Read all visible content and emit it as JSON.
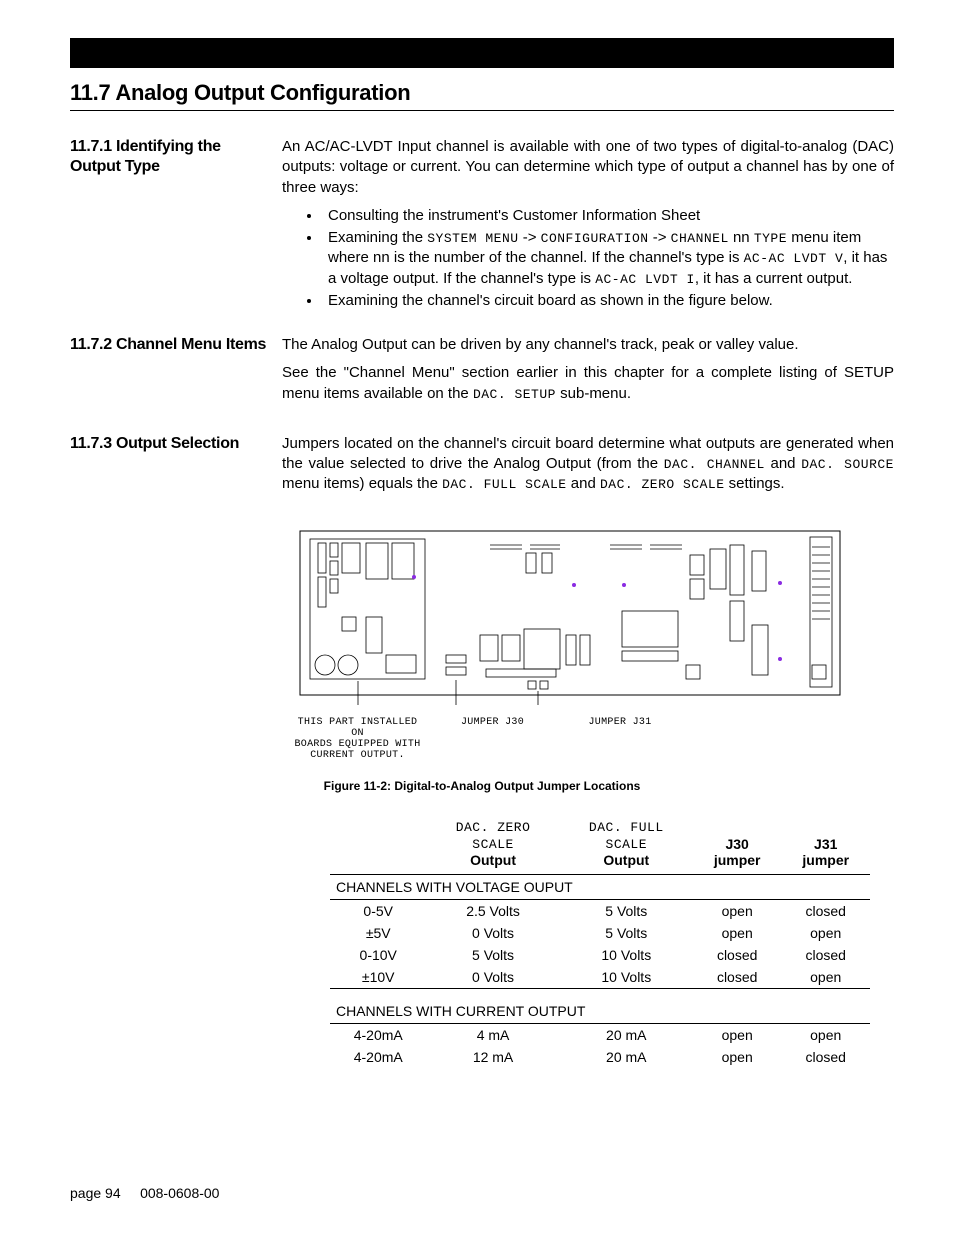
{
  "section_title": "11.7  Analog Output Configuration",
  "subsections": {
    "s1": {
      "heading": "11.7.1 Identifying the Output Type",
      "intro": "An AC/AC-LVDT Input channel is available with one of two types of digital-to-analog (DAC) outputs: voltage or current.  You can determine which type of output a channel has by one of three ways:",
      "bullets": {
        "b1": "Consulting the instrument's Customer Information Sheet",
        "b2_pre": "Examining the ",
        "b2_menu1": "SYSTEM MENU",
        "b2_mid1": " -> ",
        "b2_menu2": "CONFIGURATION",
        "b2_mid2": " -> ",
        "b2_menu3": "CHANNEL",
        "b2_mid3": " nn ",
        "b2_menu4": "TYPE",
        "b2_post1": " menu item where nn is the number of the channel. If the channel's type is ",
        "b2_type1": "AC-AC LVDT V",
        "b2_post2": ", it has a voltage output. If the channel's type is ",
        "b2_type2": "AC-AC LVDT I",
        "b2_post3": ", it has a current output.",
        "b3": "Examining the channel's circuit board as shown in the figure below."
      }
    },
    "s2": {
      "heading": "11.7.2 Channel Menu Items",
      "p1": "The Analog Output can be driven by any channel's track, peak or valley value.",
      "p2_pre": "See the \"Channel Menu\" section earlier in this chapter for a complete listing of SETUP menu items available on the ",
      "p2_mono": "DAC. SETUP",
      "p2_post": " sub-menu."
    },
    "s3": {
      "heading": "11.7.3 Output Selection",
      "p_pre": "Jumpers located on the channel's circuit board determine what outputs are generated when the value selected to drive the Analog Output (from the ",
      "p_m1": "DAC. CHANNEL",
      "p_mid1": " and ",
      "p_m2": "DAC. SOURCE",
      "p_mid2": " menu items) equals the ",
      "p_m3": "DAC. FULL SCALE",
      "p_mid3": " and ",
      "p_m4": "DAC. ZERO SCALE",
      "p_post": " settings."
    }
  },
  "diagram": {
    "install_note_l1": "THIS PART INSTALLED ON",
    "install_note_l2": "BOARDS EQUIPPED WITH",
    "install_note_l3": "CURRENT OUTPUT.",
    "j30_label": "JUMPER J30",
    "j31_label": "JUMPER J31"
  },
  "figure_caption": "Figure 11-2: Digital-to-Analog Output Jumper Locations",
  "table": {
    "headers": {
      "col1": "",
      "col2_mono": "DAC. ZERO SCALE",
      "col2_b": "Output",
      "col3_mono": "DAC. FULL SCALE",
      "col3_b": "Output",
      "col4_a": "J30",
      "col4_b": "jumper",
      "col5_a": "J31",
      "col5_b": "jumper"
    },
    "section1": "CHANNELS WITH VOLTAGE OUPUT",
    "section2": "CHANNELS WITH CURRENT OUTPUT",
    "rows_v": [
      {
        "range": "0-5V",
        "zero": "2.5 Volts",
        "full": "5 Volts",
        "j30": "open",
        "j31": "closed"
      },
      {
        "range": "±5V",
        "zero": "0 Volts",
        "full": "5 Volts",
        "j30": "open",
        "j31": "open"
      },
      {
        "range": "0-10V",
        "zero": "5 Volts",
        "full": "10 Volts",
        "j30": "closed",
        "j31": "closed"
      },
      {
        "range": "±10V",
        "zero": "0 Volts",
        "full": "10 Volts",
        "j30": "closed",
        "j31": "open"
      }
    ],
    "rows_c": [
      {
        "range": "4-20mA",
        "zero": "4 mA",
        "full": "20 mA",
        "j30": "open",
        "j31": "open"
      },
      {
        "range": "4-20mA",
        "zero": "12 mA",
        "full": "20 mA",
        "j30": "open",
        "j31": "closed"
      }
    ]
  },
  "footer": {
    "page_label": "page 94",
    "doc_num": "008-0608-00"
  }
}
